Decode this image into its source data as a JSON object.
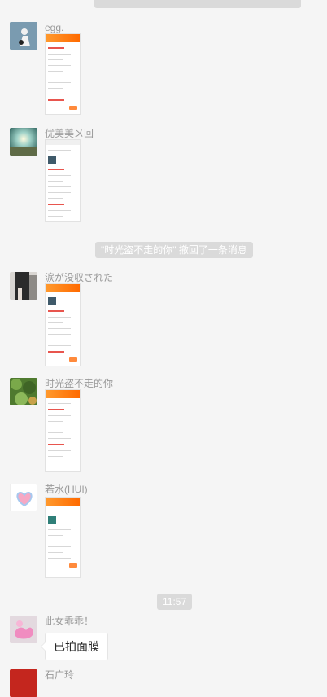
{
  "messages": [
    {
      "sender": "egg.",
      "avatar_icon": "paper-figure-avatar",
      "kind": "image"
    },
    {
      "sender": "优美美〤回",
      "avatar_icon": "sunlight-landscape-avatar",
      "kind": "image"
    },
    {
      "sender": "涙が没収された",
      "avatar_icon": "dark-figure-avatar",
      "kind": "image"
    },
    {
      "sender": "时光盗不走的你",
      "avatar_icon": "green-plants-avatar",
      "kind": "image"
    },
    {
      "sender": "若水(HUI)",
      "avatar_icon": "heart-avatar",
      "kind": "image"
    },
    {
      "sender": "此女乖乖！",
      "avatar_icon": "pink-float-avatar",
      "kind": "text",
      "text": "已拍面膜"
    },
    {
      "sender": "石广玲",
      "avatar_icon": "red-avatar",
      "kind": "text"
    }
  ],
  "system": {
    "recall": "\"时光盗不走的你\" 撤回了一条消息",
    "time": "11:57"
  },
  "colors": {
    "page_bg": "#f5f5f5",
    "accent_orange": "#ff6a00",
    "system_bg": "#dadada"
  }
}
